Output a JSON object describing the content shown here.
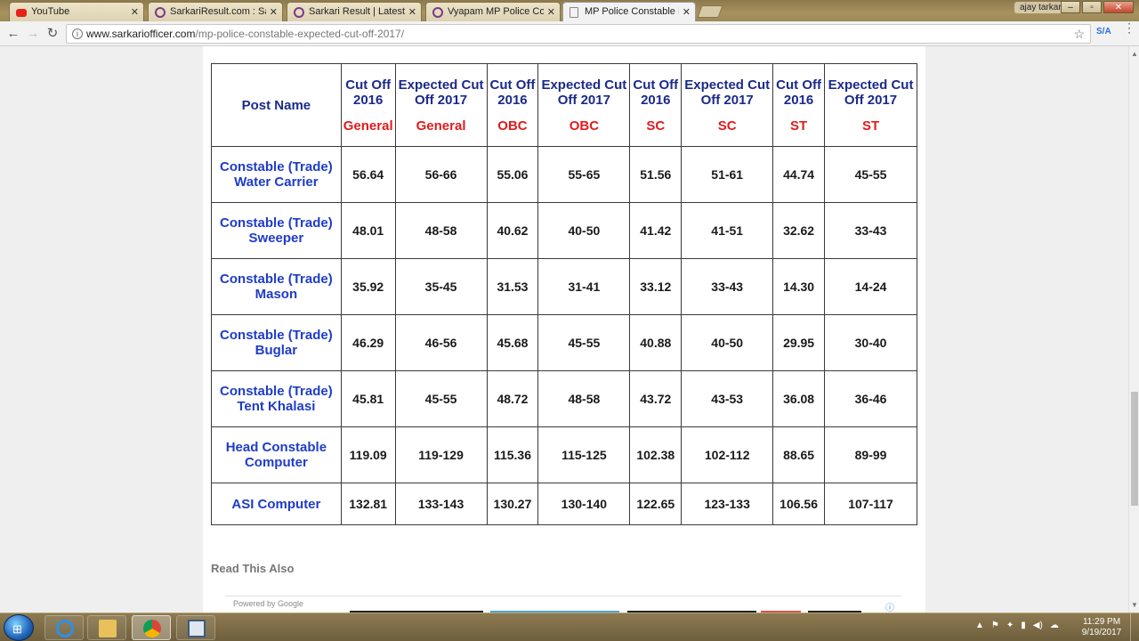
{
  "browser": {
    "tabs": [
      {
        "label": "YouTube",
        "icon": "youtube-icon",
        "color": "#e62117"
      },
      {
        "label": "SarkariResult.com : Sarkari",
        "icon": "globe-icon",
        "color": "#7a3a8a"
      },
      {
        "label": "Sarkari Result | Latest Re",
        "icon": "globe-icon",
        "color": "#7a3a8a"
      },
      {
        "label": "Vyapam MP Police Consta",
        "icon": "globe-icon",
        "color": "#7a3a8a"
      },
      {
        "label": "MP Police Constable Exp",
        "icon": "page-icon",
        "color": "#888888"
      }
    ],
    "user": "ajay tarkar",
    "url_host": "www.sarkariofficer.com",
    "url_path": "/mp-police-constable-expected-cut-off-2017/",
    "extension_label": "S/A"
  },
  "table": {
    "headers": [
      {
        "title": "Post Name",
        "category": ""
      },
      {
        "title": "Cut Off 2016",
        "category": "General"
      },
      {
        "title": "Expected Cut Off 2017",
        "category": "General"
      },
      {
        "title": "Cut Off 2016",
        "category": "OBC"
      },
      {
        "title": "Expected Cut Off 2017",
        "category": "OBC"
      },
      {
        "title": "Cut Off 2016",
        "category": "SC"
      },
      {
        "title": "Expected Cut Off 2017",
        "category": "SC"
      },
      {
        "title": "Cut Off 2016",
        "category": "ST"
      },
      {
        "title": "Expected Cut Off 2017",
        "category": "ST"
      }
    ],
    "rows": [
      [
        "Constable (Trade) Water Carrier",
        "56.64",
        "56-66",
        "55.06",
        "55-65",
        "51.56",
        "51-61",
        "44.74",
        "45-55"
      ],
      [
        "Constable (Trade) Sweeper",
        "48.01",
        "48-58",
        "40.62",
        "40-50",
        "41.42",
        "41-51",
        "32.62",
        "33-43"
      ],
      [
        "Constable (Trade) Mason",
        "35.92",
        "35-45",
        "31.53",
        "31-41",
        "33.12",
        "33-43",
        "14.30",
        "14-24"
      ],
      [
        "Constable (Trade) Buglar",
        "46.29",
        "46-56",
        "45.68",
        "45-55",
        "40.88",
        "40-50",
        "29.95",
        "30-40"
      ],
      [
        "Constable (Trade) Tent Khalasi",
        "45.81",
        "45-55",
        "48.72",
        "48-58",
        "43.72",
        "43-53",
        "36.08",
        "36-46"
      ],
      [
        "Head Constable Computer",
        "119.09",
        "119-129",
        "115.36",
        "115-125",
        "102.38",
        "102-112",
        "88.65",
        "89-99"
      ],
      [
        "ASI Computer",
        "132.81",
        "133-143",
        "130.27",
        "130-140",
        "122.65",
        "123-133",
        "106.56",
        "107-117"
      ]
    ]
  },
  "read_also": "Read This Also",
  "ad": {
    "powered_by": "Powered by Google",
    "info_icon": "info-icon"
  },
  "taskbar": {
    "apps": [
      "internet-explorer-icon",
      "file-explorer-icon",
      "chrome-icon",
      "window-icon"
    ],
    "time": "11:29 PM",
    "date": "9/19/2017"
  },
  "colors": {
    "header_text": "#1b2a8a",
    "category_text": "#e01c1c",
    "post_text": "#1f3cc8"
  }
}
